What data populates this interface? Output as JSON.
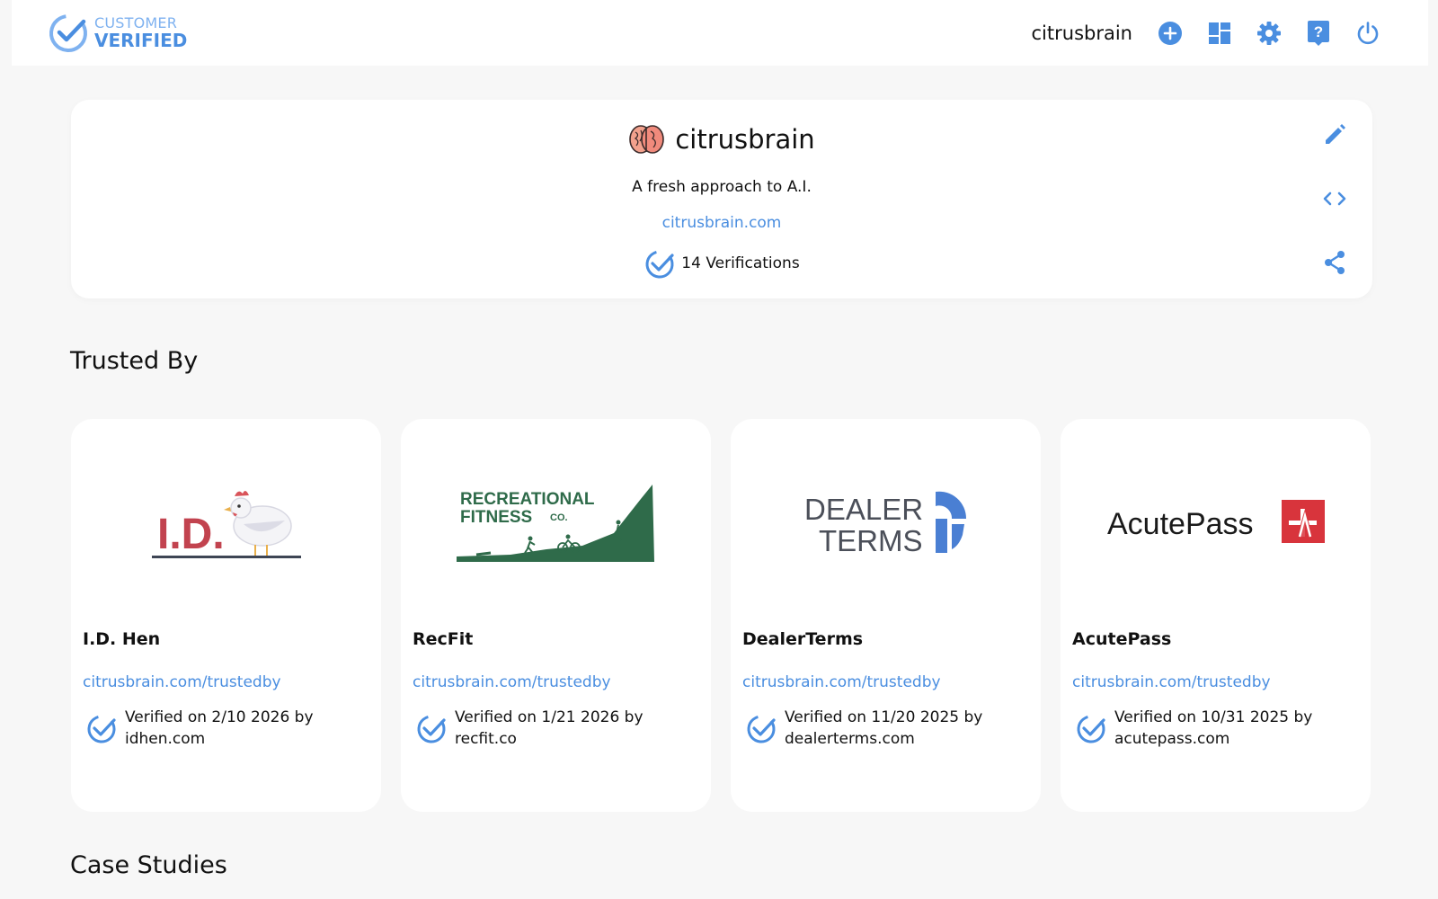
{
  "header": {
    "brand_top": "CUSTOMER",
    "brand_bottom": "VERIFIED",
    "username": "citrusbrain",
    "icons": [
      "add-circle-icon",
      "dashboard-icon",
      "gear-icon",
      "help-icon",
      "power-icon"
    ]
  },
  "profile": {
    "name": "citrusbrain",
    "logo_icon": "brain-icon",
    "tagline": "A fresh approach to A.I.",
    "website": "citrusbrain.com",
    "verifications": "14 Verifications",
    "actions": [
      "edit-icon",
      "code-icon",
      "share-icon"
    ]
  },
  "sections": {
    "trusted_by": "Trusted By",
    "case_studies": "Case Studies"
  },
  "trusted_cards": [
    {
      "name": "I.D. Hen",
      "logo_text": "I.D.",
      "link": "citrusbrain.com/trustedby",
      "verified_line1": "Verified on 2/10 2026 by",
      "verified_line2": "idhen.com"
    },
    {
      "name": "RecFit",
      "logo_text_1": "RECREATIONAL",
      "logo_text_2": "FITNESS",
      "logo_text_3": "CO.",
      "link": "citrusbrain.com/trustedby",
      "verified_line1": "Verified on 1/21 2026 by",
      "verified_line2": "recfit.co"
    },
    {
      "name": "DealerTerms",
      "logo_text_1": "DEALER",
      "logo_text_2": "TERMS",
      "link": "citrusbrain.com/trustedby",
      "verified_line1": "Verified on 11/20 2025 by",
      "verified_line2": "dealerterms.com"
    },
    {
      "name": "AcutePass",
      "logo_text": "AcutePass",
      "link": "citrusbrain.com/trustedby",
      "verified_line1": "Verified on 10/31 2025 by",
      "verified_line2": "acutepass.com"
    }
  ],
  "colors": {
    "accent": "#4a8ee0",
    "background": "#f7f7f7",
    "idhen_red": "#c2434f",
    "recfit_green": "#2f6b4a",
    "dealerterms_gray": "#4b4f59",
    "acutepass_red": "#d8343c"
  }
}
